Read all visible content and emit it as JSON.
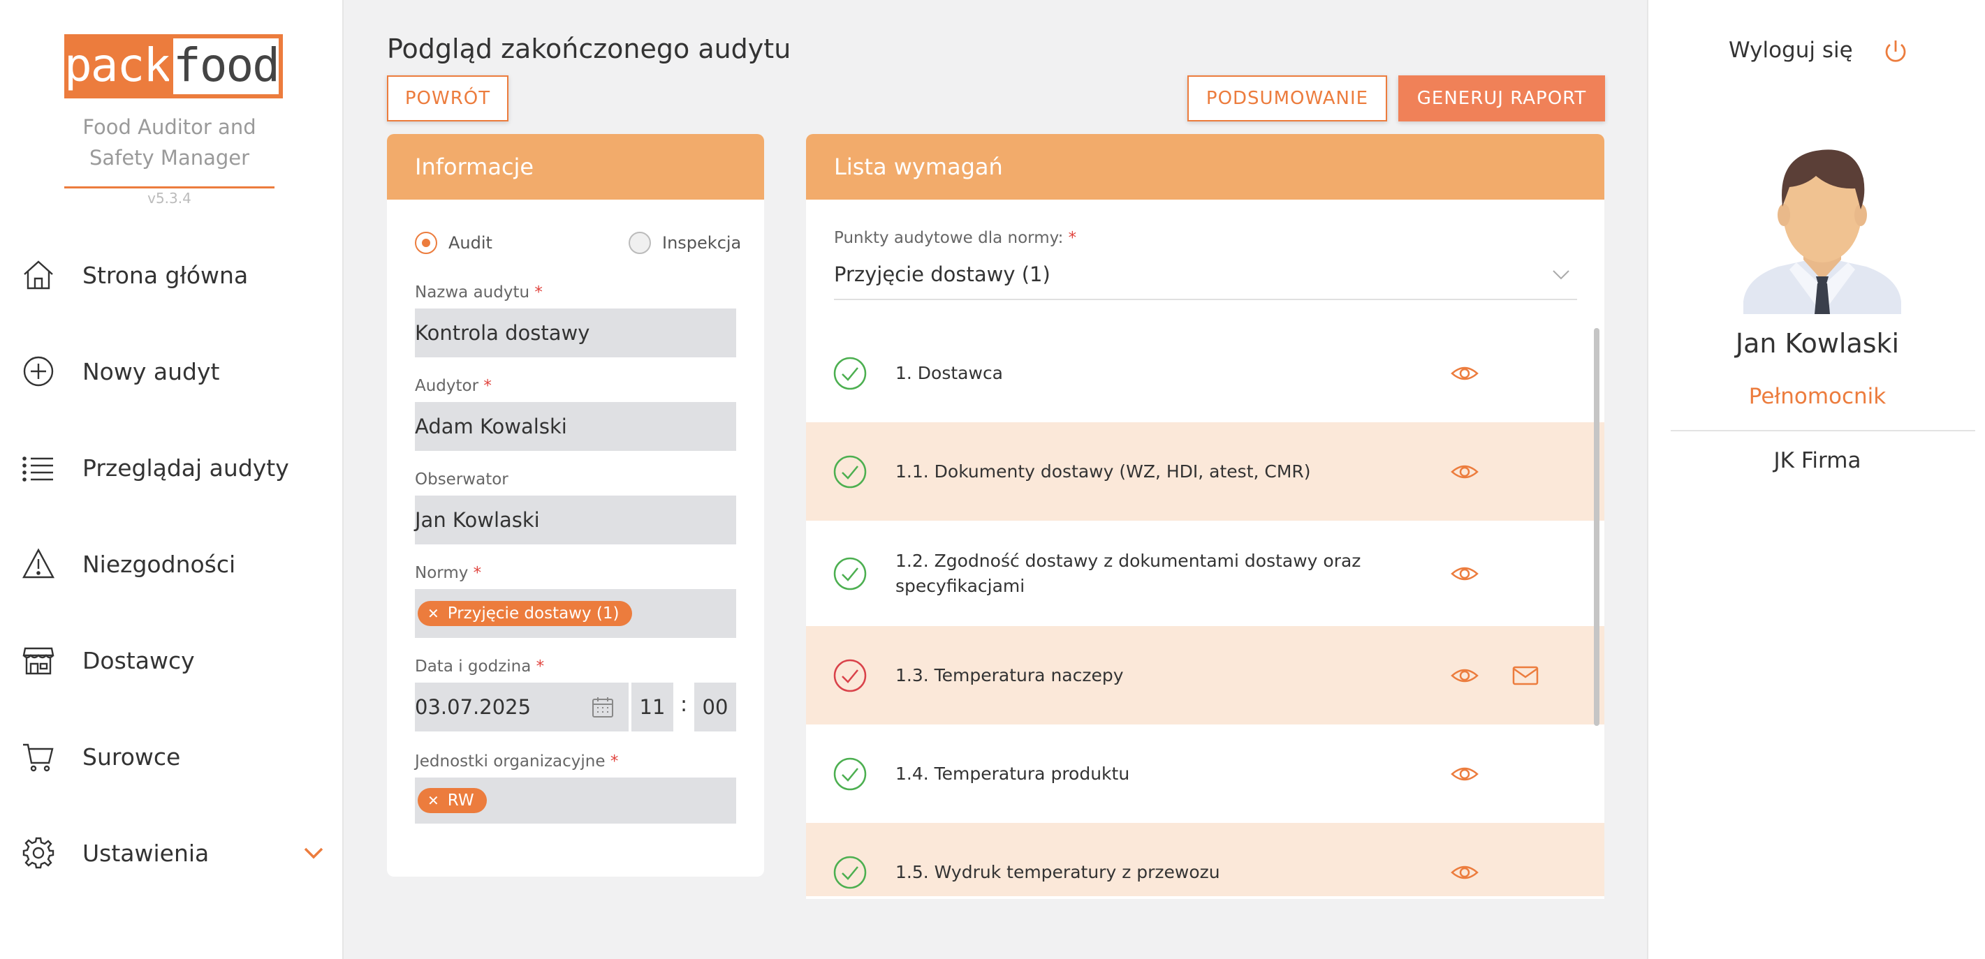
{
  "brand": {
    "pack": "pack",
    "food": "food",
    "subtitle": "Food Auditor and Safety Manager",
    "version": "v5.3.4",
    "accent": "#ec7c3d"
  },
  "sidebar": {
    "items": [
      {
        "label": "Strona główna",
        "icon": "home-icon"
      },
      {
        "label": "Nowy audyt",
        "icon": "plus-circle-icon"
      },
      {
        "label": "Przeglądaj audyty",
        "icon": "list-icon"
      },
      {
        "label": "Niezgodności",
        "icon": "warning-icon"
      },
      {
        "label": "Dostawcy",
        "icon": "store-icon"
      },
      {
        "label": "Surowce",
        "icon": "cart-icon"
      },
      {
        "label": "Ustawienia",
        "icon": "gear-icon"
      }
    ]
  },
  "page": {
    "title": "Podgląd zakończonego audytu",
    "back_label": "POWRÓT",
    "summary_label": "PODSUMOWANIE",
    "report_label": "GENERUJ RAPORT"
  },
  "info": {
    "header": "Informacje",
    "radio_audit": "Audit",
    "radio_inspection": "Inspekcja",
    "audit_name_label": "Nazwa audytu",
    "audit_name": "Kontrola dostawy",
    "auditor_label": "Audytor",
    "auditor": "Adam Kowalski",
    "observer_label": "Obserwator",
    "observer": "Jan Kowlaski",
    "norms_label": "Normy",
    "norm_chip": "Przyjęcie dostawy (1)",
    "date_label": "Data i godzina",
    "date": "03.07.2025",
    "hour": "11",
    "time_sep": ":",
    "minute": "00",
    "units_label": "Jednostki organizacyjne",
    "unit_chip": "RW",
    "required_mark": "*"
  },
  "requirements": {
    "header": "Lista wymagań",
    "select_label": "Punkty audytowe dla normy:",
    "select_value": "Przyjęcie dostawy (1)",
    "items": [
      {
        "text": "1. Dostawca",
        "status": "ok"
      },
      {
        "text": "1.1. Dokumenty dostawy (WZ, HDI, atest, CMR)",
        "status": "ok"
      },
      {
        "text": "1.2. Zgodność dostawy z dokumentami dostawy oraz specyfikacjami",
        "status": "ok"
      },
      {
        "text": "1.3. Temperatura naczepy",
        "status": "fail"
      },
      {
        "text": "1.4. Temperatura produktu",
        "status": "ok"
      },
      {
        "text": "1.5. Wydruk temperatury z przewozu",
        "status": "ok"
      }
    ],
    "colors": {
      "ok": "#4caf50",
      "fail": "#d9424a"
    }
  },
  "user": {
    "logout": "Wyloguj się",
    "name": "Jan Kowlaski",
    "role": "Pełnomocnik",
    "company": "JK Firma"
  }
}
